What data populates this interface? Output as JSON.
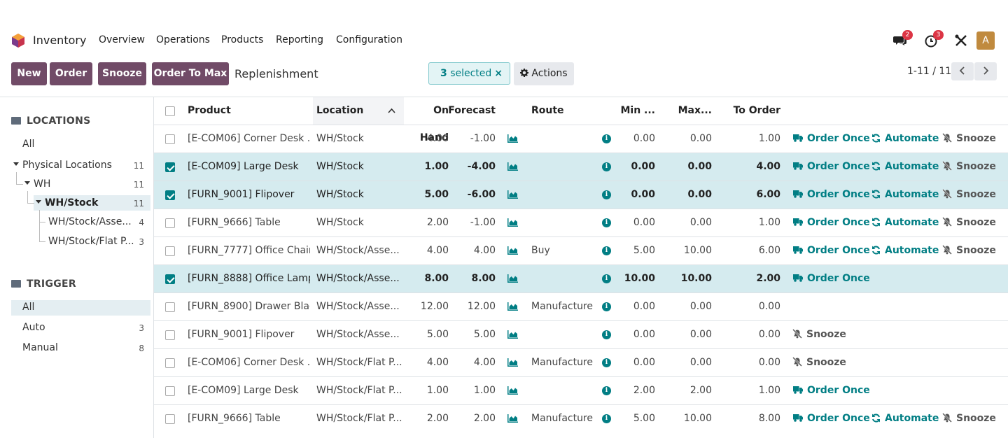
{
  "nav": {
    "app_name": "Inventory",
    "menu": [
      "Overview",
      "Operations",
      "Products",
      "Reporting",
      "Configuration"
    ],
    "messages_badge": "2",
    "activities_badge": "3",
    "avatar_letter": "A"
  },
  "control": {
    "buttons": [
      "New",
      "Order",
      "Snooze",
      "Order To Max"
    ],
    "breadcrumb": "Replenishment",
    "selected_count": "3",
    "selected_label": "selected",
    "clear_symbol": "×",
    "actions_label": "Actions",
    "pager": "1-11 / 11"
  },
  "sidebar": {
    "locations_header": "LOCATIONS",
    "locations": [
      {
        "label": "All",
        "count": ""
      },
      {
        "label": "Physical Locations",
        "count": "11"
      },
      {
        "label": "WH",
        "count": "11"
      },
      {
        "label": "WH/Stock",
        "count": "11"
      },
      {
        "label": "WH/Stock/Asse...",
        "count": "4"
      },
      {
        "label": "WH/Stock/Flat P...",
        "count": "3"
      }
    ],
    "trigger_header": "TRIGGER",
    "triggers": [
      {
        "label": "All",
        "count": ""
      },
      {
        "label": "Auto",
        "count": "3"
      },
      {
        "label": "Manual",
        "count": "8"
      }
    ]
  },
  "table": {
    "headers": {
      "product": "Product",
      "location": "Location",
      "on_hand": "On Hand",
      "forecast": "Forecast",
      "route": "Route",
      "min": "Min ...",
      "max": "Max...",
      "to_order": "To Order"
    },
    "action_labels": {
      "order_once": "Order Once",
      "automate": "Automate",
      "snooze": "Snooze"
    },
    "rows": [
      {
        "product": "[E-COM06] Corner Desk ...",
        "location": "WH/Stock",
        "on_hand": "4.00",
        "forecast": "-1.00",
        "route": "",
        "min": "0.00",
        "max": "0.00",
        "to_order": "1.00"
      },
      {
        "product": "[E-COM09] Large Desk",
        "location": "WH/Stock",
        "on_hand": "1.00",
        "forecast": "-4.00",
        "route": "",
        "min": "0.00",
        "max": "0.00",
        "to_order": "4.00"
      },
      {
        "product": "[FURN_9001] Flipover",
        "location": "WH/Stock",
        "on_hand": "5.00",
        "forecast": "-6.00",
        "route": "",
        "min": "0.00",
        "max": "0.00",
        "to_order": "6.00"
      },
      {
        "product": "[FURN_9666] Table",
        "location": "WH/Stock",
        "on_hand": "2.00",
        "forecast": "-1.00",
        "route": "",
        "min": "0.00",
        "max": "0.00",
        "to_order": "1.00"
      },
      {
        "product": "[FURN_7777] Office Chair",
        "location": "WH/Stock/Asse...",
        "on_hand": "4.00",
        "forecast": "4.00",
        "route": "Buy",
        "min": "5.00",
        "max": "10.00",
        "to_order": "6.00"
      },
      {
        "product": "[FURN_8888] Office Lamp",
        "location": "WH/Stock/Asse...",
        "on_hand": "8.00",
        "forecast": "8.00",
        "route": "",
        "min": "10.00",
        "max": "10.00",
        "to_order": "2.00"
      },
      {
        "product": "[FURN_8900] Drawer Black",
        "location": "WH/Stock/Asse...",
        "on_hand": "12.00",
        "forecast": "12.00",
        "route": "Manufacture",
        "min": "0.00",
        "max": "0.00",
        "to_order": "0.00"
      },
      {
        "product": "[FURN_9001] Flipover",
        "location": "WH/Stock/Asse...",
        "on_hand": "5.00",
        "forecast": "5.00",
        "route": "",
        "min": "0.00",
        "max": "0.00",
        "to_order": "0.00"
      },
      {
        "product": "[E-COM06] Corner Desk ...",
        "location": "WH/Stock/Flat P...",
        "on_hand": "4.00",
        "forecast": "4.00",
        "route": "Manufacture",
        "min": "0.00",
        "max": "0.00",
        "to_order": "0.00"
      },
      {
        "product": "[E-COM09] Large Desk",
        "location": "WH/Stock/Flat P...",
        "on_hand": "1.00",
        "forecast": "1.00",
        "route": "",
        "min": "2.00",
        "max": "2.00",
        "to_order": "1.00"
      },
      {
        "product": "[FURN_9666] Table",
        "location": "WH/Stock/Flat P...",
        "on_hand": "2.00",
        "forecast": "2.00",
        "route": "Manufacture",
        "min": "5.00",
        "max": "10.00",
        "to_order": "8.00"
      }
    ]
  }
}
